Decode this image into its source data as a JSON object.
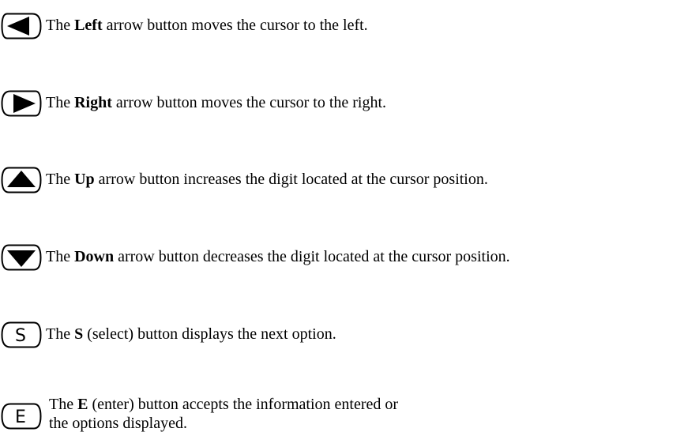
{
  "items": [
    {
      "icon": "left-arrow-icon",
      "prefix": "The ",
      "bold": "Left",
      "suffix": " arrow button moves the cursor to the left."
    },
    {
      "icon": "right-arrow-icon",
      "prefix": "The ",
      "bold": "Right",
      "suffix": " arrow button moves the cursor to the right."
    },
    {
      "icon": "up-arrow-icon",
      "prefix": "The ",
      "bold": "Up",
      "suffix": " arrow button increases the digit located at the cursor position."
    },
    {
      "icon": "down-arrow-icon",
      "prefix": "The ",
      "bold": "Down",
      "suffix": " arrow button decreases the digit located at the cursor position."
    },
    {
      "icon": "select-s-icon",
      "icon_letter": "S",
      "prefix": "The ",
      "bold": "S",
      "suffix": " (select) button displays the next option."
    },
    {
      "icon": "enter-e-icon",
      "icon_letter": "E",
      "prefix": " The ",
      "bold": "E",
      "suffix": " (enter) button accepts the information entered or the options displayed."
    }
  ]
}
